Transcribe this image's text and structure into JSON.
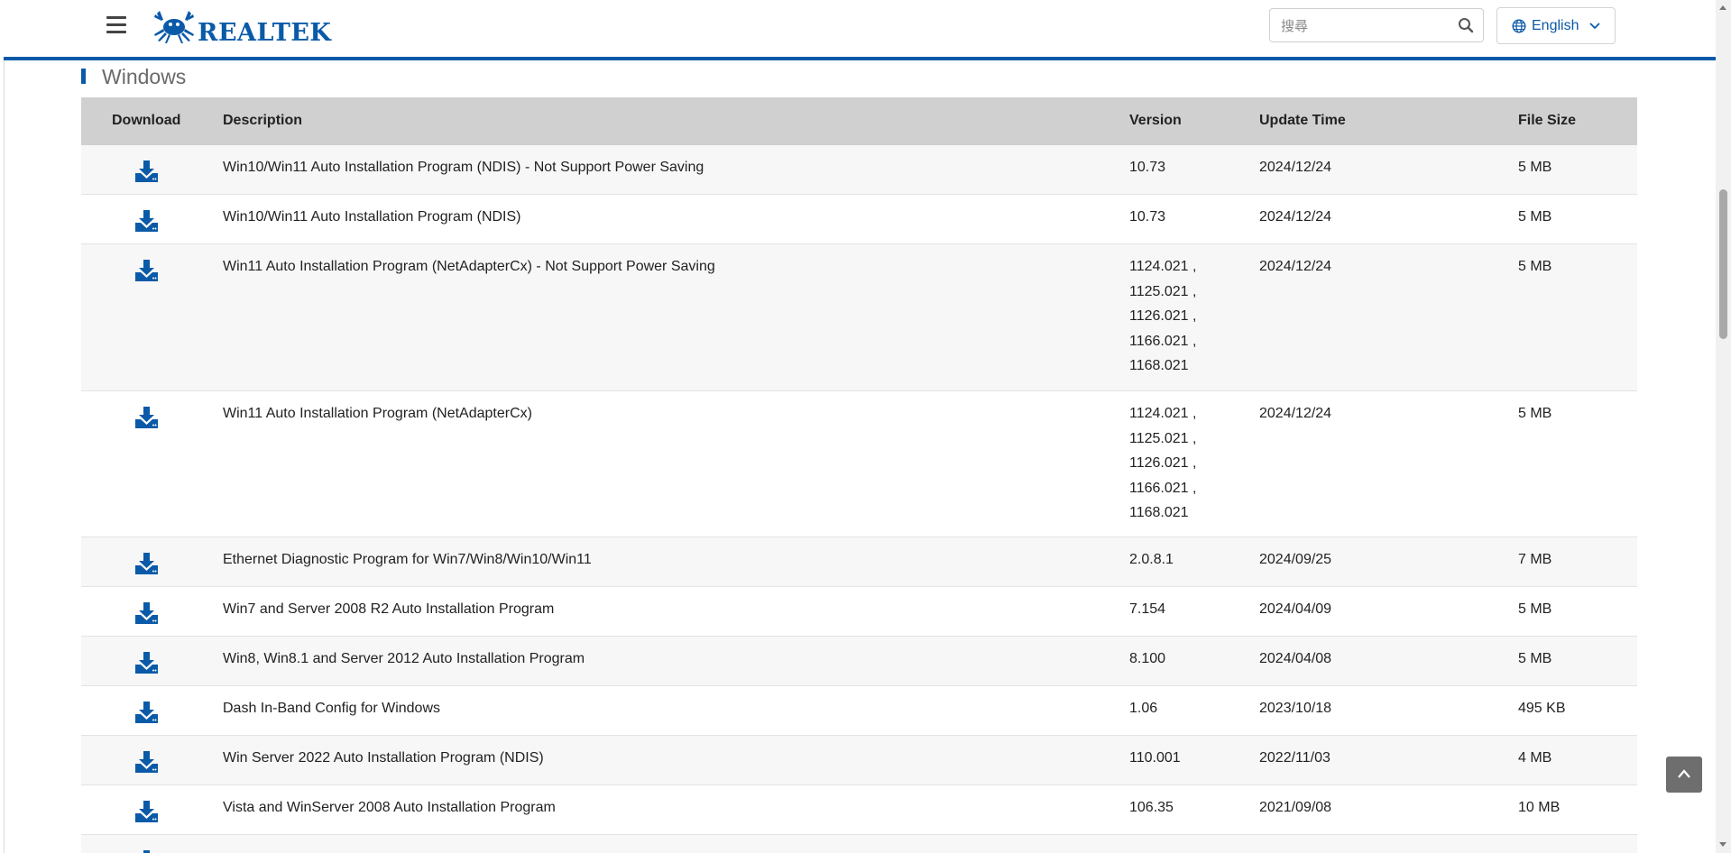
{
  "header": {
    "brand": "REALTEK",
    "search_placeholder": "搜尋",
    "language": "English"
  },
  "section": {
    "title": "Windows"
  },
  "table": {
    "columns": {
      "download": "Download",
      "description": "Description",
      "version": "Version",
      "update_time": "Update Time",
      "file_size": "File Size"
    },
    "rows": [
      {
        "description": "Win10/Win11 Auto Installation Program (NDIS) - Not Support Power Saving",
        "version": [
          "10.73"
        ],
        "update_time": "2024/12/24",
        "file_size": "5 MB"
      },
      {
        "description": "Win10/Win11 Auto Installation Program (NDIS)",
        "version": [
          "10.73"
        ],
        "update_time": "2024/12/24",
        "file_size": "5 MB"
      },
      {
        "description": "Win11 Auto Installation Program (NetAdapterCx) - Not Support Power Saving",
        "version": [
          "1124.021 ,",
          "1125.021 ,",
          "1126.021 ,",
          "1166.021 ,",
          "1168.021"
        ],
        "update_time": "2024/12/24",
        "file_size": "5 MB"
      },
      {
        "description": "Win11 Auto Installation Program (NetAdapterCx)",
        "version": [
          "1124.021 ,",
          "1125.021 ,",
          "1126.021 ,",
          "1166.021 ,",
          "1168.021"
        ],
        "update_time": "2024/12/24",
        "file_size": "5 MB"
      },
      {
        "description": "Ethernet Diagnostic Program for Win7/Win8/Win10/Win11",
        "version": [
          "2.0.8.1"
        ],
        "update_time": "2024/09/25",
        "file_size": "7 MB"
      },
      {
        "description": "Win7 and Server 2008 R2 Auto Installation Program",
        "version": [
          "7.154"
        ],
        "update_time": "2024/04/09",
        "file_size": "5 MB"
      },
      {
        "description": "Win8, Win8.1 and Server 2012 Auto Installation Program",
        "version": [
          "8.100"
        ],
        "update_time": "2024/04/08",
        "file_size": "5 MB"
      },
      {
        "description": "Dash In-Band Config for Windows",
        "version": [
          "1.06"
        ],
        "update_time": "2023/10/18",
        "file_size": "495 KB"
      },
      {
        "description": "Win Server 2022 Auto Installation Program (NDIS)",
        "version": [
          "110.001"
        ],
        "update_time": "2022/11/03",
        "file_size": "4 MB"
      },
      {
        "description": "Vista and WinServer 2008 Auto Installation Program",
        "version": [
          "106.35"
        ],
        "update_time": "2021/09/08",
        "file_size": "10 MB"
      },
      {
        "description": "",
        "version": [
          ""
        ],
        "update_time": "",
        "file_size": ""
      }
    ]
  },
  "icons": {
    "menu": "hamburger-menu-icon",
    "search": "search-icon",
    "globe": "globe-icon",
    "chevron": "chevron-down-icon",
    "download": "download-icon",
    "back_to_top": "chevron-up-icon"
  },
  "colors": {
    "brand_blue": "#0a5aa8",
    "header_row_bg": "#d0d0d0",
    "odd_row_bg": "#f7f7f7"
  }
}
